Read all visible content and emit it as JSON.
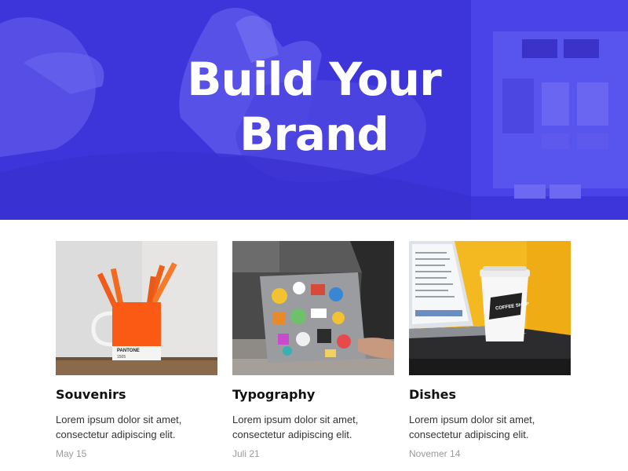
{
  "hero": {
    "title_line1": "Build Your",
    "title_line2": "Brand",
    "overlay_color": "#4035dc"
  },
  "cards": [
    {
      "title": "Souvenirs",
      "text_line1": "Lorem ipsum dolor sit amet,",
      "text_line2": "consectetur adipiscing elit.",
      "date": "May 15",
      "image_icon": "pencil-mug-image",
      "mug_label": "PANTONE",
      "mug_code": "1505"
    },
    {
      "title": "Typography",
      "text_line1": "Lorem ipsum dolor sit amet,",
      "text_line2": "consectetur adipiscing elit.",
      "date": "Juli 21",
      "image_icon": "laptop-stickers-image"
    },
    {
      "title": "Dishes",
      "text_line1": "Lorem ipsum dolor sit amet,",
      "text_line2": "consectetur adipiscing elit.",
      "date": "Novemer 14",
      "image_icon": "coffee-cup-image",
      "cup_text": "COFFEE SHOP"
    }
  ]
}
